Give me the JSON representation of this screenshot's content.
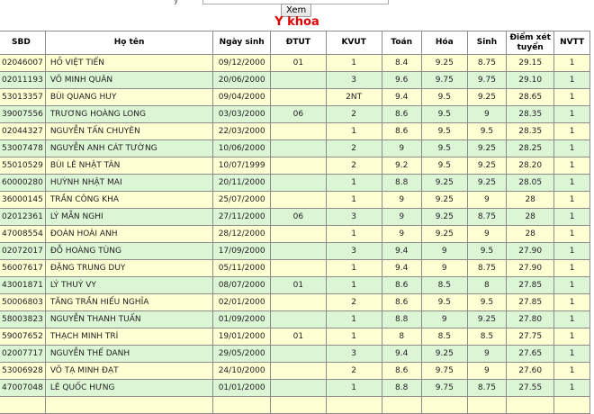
{
  "toolbar": {
    "glyph": "ý",
    "view_label": "Xem"
  },
  "page": {
    "title": "Y khoa"
  },
  "table": {
    "headers": {
      "sbd": "SBD",
      "name": "Họ tên",
      "dob": "Ngày sinh",
      "dtut": "ĐTUT",
      "kvut": "KVUT",
      "toan": "Toán",
      "hoa": "Hóa",
      "sinh": "Sinh",
      "diem": "Điểm xét tuyển",
      "nvtt": "NVTT"
    },
    "rows": [
      {
        "sbd": "02046007",
        "name": "HỒ VIỆT TIẾN",
        "dob": "09/12/2000",
        "dtut": "01",
        "kvut": "1",
        "toan": "8.4",
        "hoa": "9.25",
        "sinh": "8.75",
        "diem": "29.15",
        "nvtt": "1"
      },
      {
        "sbd": "02011193",
        "name": "VÕ MINH QUÂN",
        "dob": "20/06/2000",
        "dtut": "",
        "kvut": "3",
        "toan": "9.6",
        "hoa": "9.75",
        "sinh": "9.75",
        "diem": "29.10",
        "nvtt": "1"
      },
      {
        "sbd": "53013357",
        "name": "BÙI QUANG HUY",
        "dob": "09/04/2000",
        "dtut": "",
        "kvut": "2NT",
        "toan": "9.4",
        "hoa": "9.5",
        "sinh": "9.25",
        "diem": "28.65",
        "nvtt": "1"
      },
      {
        "sbd": "39007556",
        "name": "TRƯƠNG HOÀNG LONG",
        "dob": "03/03/2000",
        "dtut": "06",
        "kvut": "2",
        "toan": "8.6",
        "hoa": "9.5",
        "sinh": "9",
        "diem": "28.35",
        "nvtt": "1"
      },
      {
        "sbd": "02044327",
        "name": "NGUYỄN TẤN CHUYÊN",
        "dob": "22/03/2000",
        "dtut": "",
        "kvut": "1",
        "toan": "8.6",
        "hoa": "9.5",
        "sinh": "9.5",
        "diem": "28.35",
        "nvtt": "1"
      },
      {
        "sbd": "53007478",
        "name": "NGUYỄN ANH CÁT TƯỜNG",
        "dob": "10/06/2000",
        "dtut": "",
        "kvut": "2",
        "toan": "9",
        "hoa": "9.5",
        "sinh": "9.25",
        "diem": "28.25",
        "nvtt": "1"
      },
      {
        "sbd": "55010529",
        "name": "BÙI LÊ NHẬT TÂN",
        "dob": "10/07/1999",
        "dtut": "",
        "kvut": "2",
        "toan": "9.2",
        "hoa": "9.5",
        "sinh": "9.25",
        "diem": "28.20",
        "nvtt": "1"
      },
      {
        "sbd": "60000280",
        "name": "HUỲNH NHẬT MAI",
        "dob": "20/11/2000",
        "dtut": "",
        "kvut": "1",
        "toan": "8.8",
        "hoa": "9.25",
        "sinh": "9.25",
        "diem": "28.05",
        "nvtt": "1"
      },
      {
        "sbd": "36000145",
        "name": "TRẦN CÔNG KHA",
        "dob": "25/07/2000",
        "dtut": "",
        "kvut": "1",
        "toan": "9",
        "hoa": "9.25",
        "sinh": "9",
        "diem": "28",
        "nvtt": "1"
      },
      {
        "sbd": "02012361",
        "name": "LÝ MẪN NGHI",
        "dob": "27/11/2000",
        "dtut": "06",
        "kvut": "3",
        "toan": "9",
        "hoa": "9.25",
        "sinh": "8.75",
        "diem": "28",
        "nvtt": "1"
      },
      {
        "sbd": "47008554",
        "name": "ĐOÀN HOÀI ANH",
        "dob": "28/12/2000",
        "dtut": "",
        "kvut": "1",
        "toan": "9",
        "hoa": "9.25",
        "sinh": "9",
        "diem": "28",
        "nvtt": "1"
      },
      {
        "sbd": "02072017",
        "name": "ĐỖ HOÀNG TÙNG",
        "dob": "17/09/2000",
        "dtut": "",
        "kvut": "3",
        "toan": "9.4",
        "hoa": "9",
        "sinh": "9.5",
        "diem": "27.90",
        "nvtt": "1"
      },
      {
        "sbd": "56007617",
        "name": "ĐẶNG TRUNG DUY",
        "dob": "05/11/2000",
        "dtut": "",
        "kvut": "1",
        "toan": "9.4",
        "hoa": "9",
        "sinh": "8.75",
        "diem": "27.90",
        "nvtt": "1"
      },
      {
        "sbd": "43001871",
        "name": "LÝ THUÝ VY",
        "dob": "08/07/2000",
        "dtut": "01",
        "kvut": "1",
        "toan": "8.6",
        "hoa": "8.5",
        "sinh": "8",
        "diem": "27.85",
        "nvtt": "1"
      },
      {
        "sbd": "50006803",
        "name": "TĂNG TRẦN HIẾU NGHĨA",
        "dob": "02/01/2000",
        "dtut": "",
        "kvut": "2",
        "toan": "8.6",
        "hoa": "9.5",
        "sinh": "9.5",
        "diem": "27.85",
        "nvtt": "1"
      },
      {
        "sbd": "58003823",
        "name": "NGUYỄN THANH TUẤN",
        "dob": "01/09/2000",
        "dtut": "",
        "kvut": "1",
        "toan": "8.8",
        "hoa": "9",
        "sinh": "9.25",
        "diem": "27.80",
        "nvtt": "1"
      },
      {
        "sbd": "59007652",
        "name": "THẠCH MINH TRÍ",
        "dob": "19/01/2000",
        "dtut": "01",
        "kvut": "1",
        "toan": "8",
        "hoa": "8.5",
        "sinh": "8.5",
        "diem": "27.75",
        "nvtt": "1"
      },
      {
        "sbd": "02007717",
        "name": "NGUYỄN THẾ DANH",
        "dob": "29/05/2000",
        "dtut": "",
        "kvut": "3",
        "toan": "9.4",
        "hoa": "9.25",
        "sinh": "9",
        "diem": "27.65",
        "nvtt": "1"
      },
      {
        "sbd": "53006928",
        "name": "VÕ TẠ MINH ĐẠT",
        "dob": "24/10/2000",
        "dtut": "",
        "kvut": "2",
        "toan": "8.6",
        "hoa": "9.75",
        "sinh": "9",
        "diem": "27.60",
        "nvtt": "1"
      },
      {
        "sbd": "47007048",
        "name": "LÊ QUỐC HƯNG",
        "dob": "01/01/2000",
        "dtut": "",
        "kvut": "1",
        "toan": "8.8",
        "hoa": "9.75",
        "sinh": "8.75",
        "diem": "27.55",
        "nvtt": "1"
      },
      {
        "sbd": "",
        "name": "",
        "dob": "",
        "dtut": "",
        "kvut": "",
        "toan": "",
        "hoa": "",
        "sinh": "",
        "diem": "",
        "nvtt": ""
      }
    ]
  }
}
